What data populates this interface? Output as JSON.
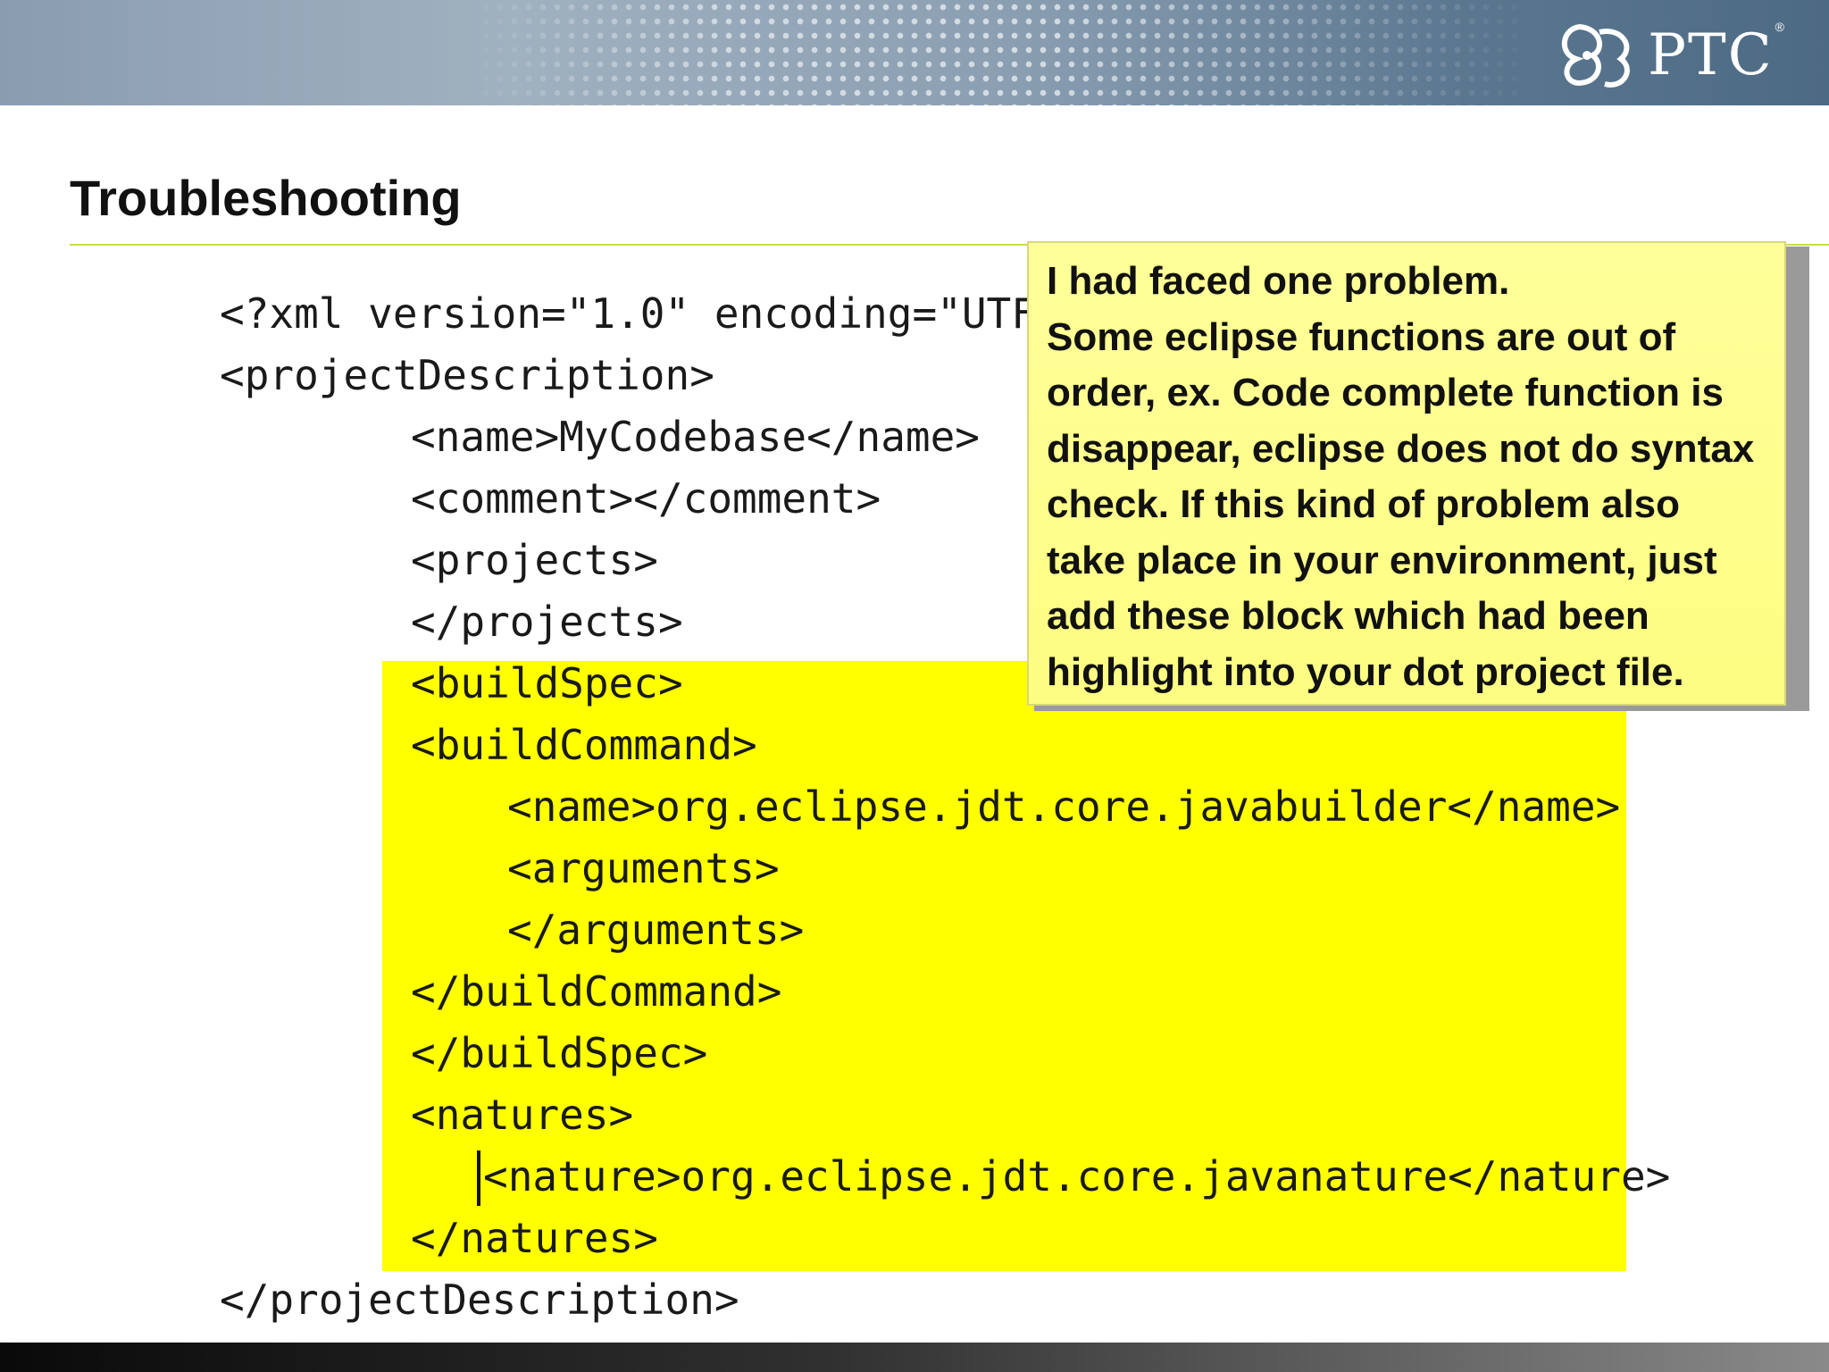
{
  "header": {
    "logo_text": "PTC",
    "logo_reg": "®"
  },
  "slide": {
    "title": "Troubleshooting"
  },
  "code_lines": [
    "<?xml version=\"1.0\" encoding=\"UTF-",
    "<projectDescription>",
    "<name>MyCodebase</name>",
    "<comment></comment>",
    "<projects>",
    "</projects>",
    "<buildSpec>",
    "<buildCommand>",
    "<name>org.eclipse.jdt.core.javabuilder</name>",
    "<arguments>",
    "</arguments>",
    "</buildCommand>",
    "</buildSpec>",
    "<natures>",
    "<nature>org.eclipse.jdt.core.javanature</nature>",
    "</natures>",
    "</projectDescription>"
  ],
  "callout": {
    "text": "I had faced one problem.\nSome eclipse functions are out of\norder, ex. Code complete function is\ndisappear, eclipse does not do syntax\ncheck. If this kind of problem also\ntake place in your environment, just\nadd these block which had been\nhighlight into your dot project file."
  },
  "colors": {
    "highlight": "#ffff00",
    "callout_bg": "#ffff9a",
    "title_rule": "#c9dc4a",
    "header": "#8a9db0"
  }
}
